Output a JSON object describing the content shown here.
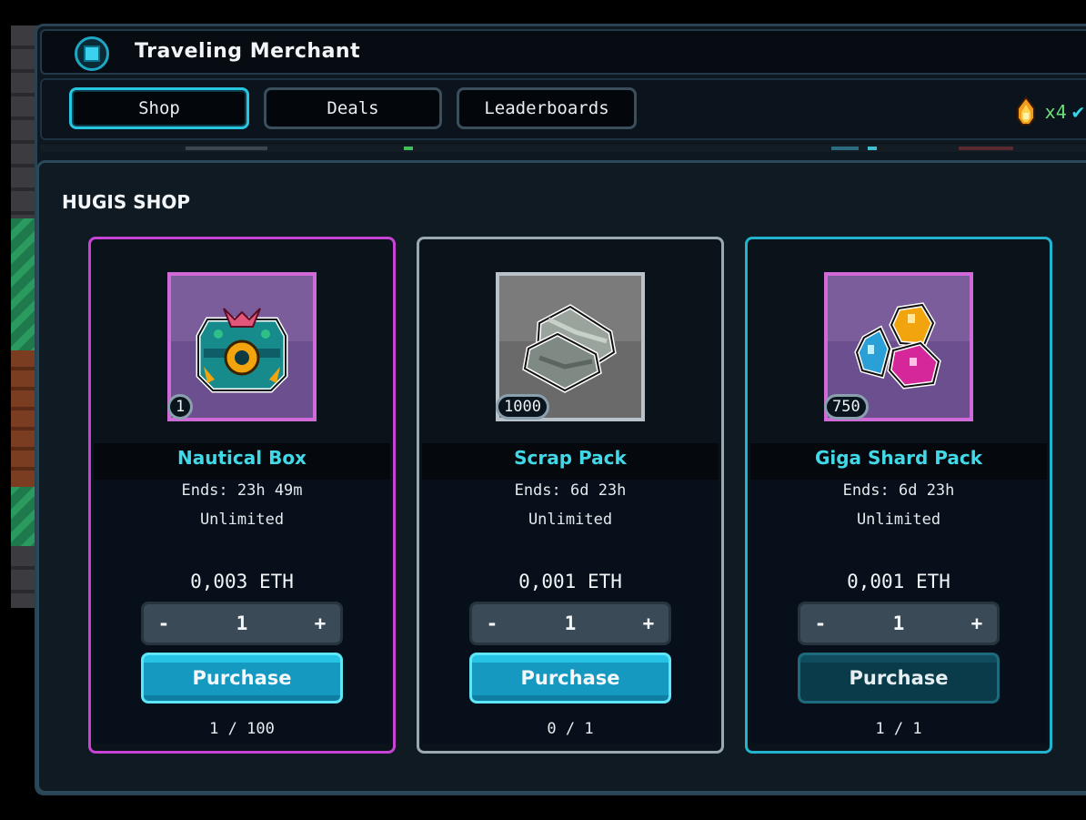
{
  "window": {
    "title": "Traveling Merchant"
  },
  "tabs": [
    {
      "label": "Shop",
      "active": true
    },
    {
      "label": "Deals",
      "active": false
    },
    {
      "label": "Leaderboards",
      "active": false
    }
  ],
  "currency": {
    "icon": "flame-gem-icon",
    "count": "x4",
    "status_icon": "check-icon"
  },
  "section": {
    "title": "HUGIS SHOP"
  },
  "items": [
    {
      "name": "Nautical Box",
      "quantity": "1",
      "ends": "Ends: 23h 49m",
      "limit": "Unlimited",
      "price": "0,003 ETH",
      "amount": "1",
      "minus": "-",
      "plus": "+",
      "purchase_label": "Purchase",
      "purchase_enabled": true,
      "sold": "1 / 100",
      "frame_color": "#c643d6",
      "icon": "treasure-chest-icon"
    },
    {
      "name": "Scrap Pack",
      "quantity": "1000",
      "ends": "Ends: 6d 23h",
      "limit": "Unlimited",
      "price": "0,001 ETH",
      "amount": "1",
      "minus": "-",
      "plus": "+",
      "purchase_label": "Purchase",
      "purchase_enabled": true,
      "sold": "0 / 1",
      "frame_color": "#9aa8b0",
      "icon": "scrap-metal-icon"
    },
    {
      "name": "Giga Shard Pack",
      "quantity": "750",
      "ends": "Ends: 6d 23h",
      "limit": "Unlimited",
      "price": "0,001 ETH",
      "amount": "1",
      "minus": "-",
      "plus": "+",
      "purchase_label": "Purchase",
      "purchase_enabled": false,
      "sold": "1 / 1",
      "frame_color": "#22b4cf",
      "icon": "gem-shards-icon"
    }
  ]
}
